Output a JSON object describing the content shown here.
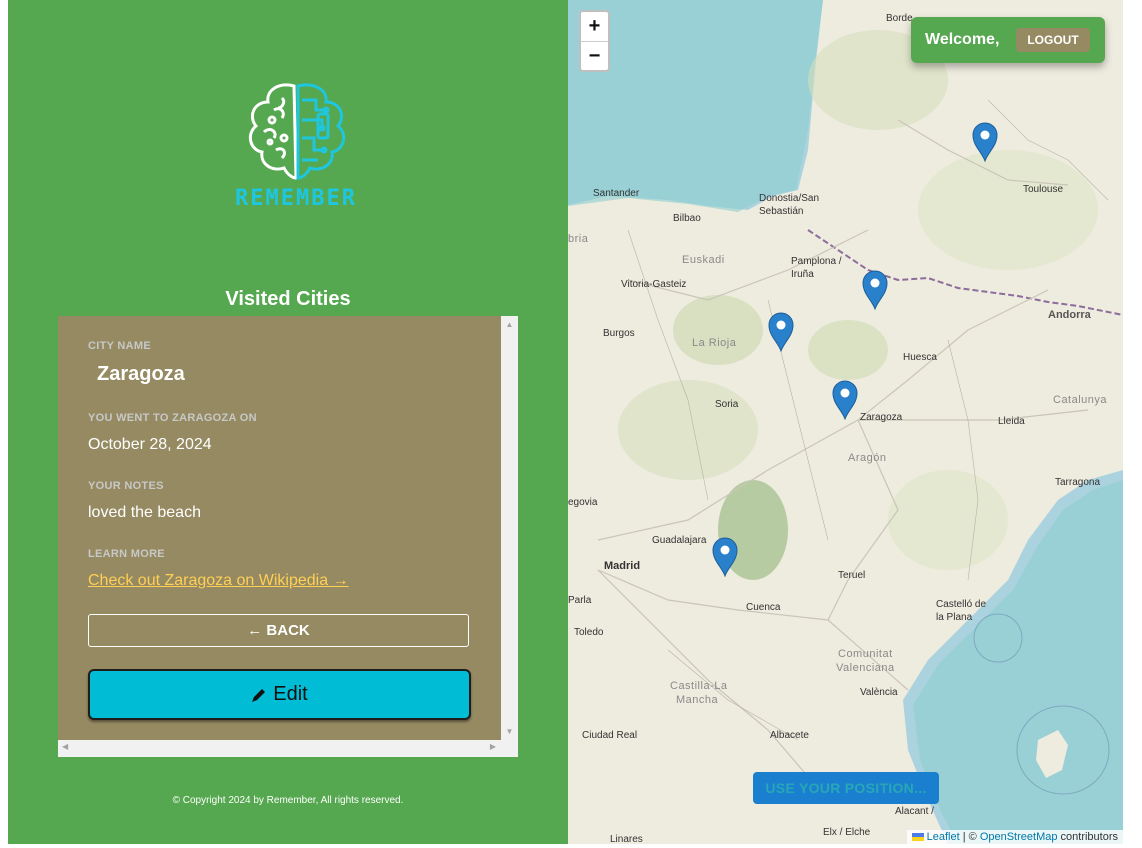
{
  "sidebar": {
    "logo_text": "REMEMBER",
    "section_title": "Visited Cities",
    "city_label": "City name",
    "city_name": "Zaragoza",
    "date_label": "You went to Zaragoza on",
    "date_value": "October 28, 2024",
    "notes_label": "Your notes",
    "notes_value": "loved the beach",
    "learn_label": "Learn more",
    "wiki_link": "Check out Zaragoza on Wikipedia →",
    "back_button": "← BACK",
    "edit_button": "Edit",
    "footer": "© Copyright 2024 by Remember, All rights reserved."
  },
  "map": {
    "zoom_in": "+",
    "zoom_out": "−",
    "welcome": "Welcome,",
    "logout": "LOGOUT",
    "position_button": "USE YOUR POSITION...",
    "attribution": {
      "leaflet": "Leaflet",
      "separator": " | © ",
      "osm": "OpenStreetMap",
      "contributors": " contributors"
    },
    "places": {
      "bordeaux": "Borde",
      "toulouse": "Toulouse",
      "santander": "Santander",
      "bilbao": "Bilbao",
      "donostia": "Donostia/San",
      "sebastian": "Sebastián",
      "euskadi": "Euskadi",
      "pamplona": "Pamplona /",
      "iruna": "Iruña",
      "vitoria": "Vitoria-Gasteiz",
      "andorra": "Andorra",
      "burgos": "Burgos",
      "larioja": "La Rioja",
      "huesca": "Huesca",
      "cataluna": "Catalunya",
      "soria": "Soria",
      "zaragoza": "Zaragoza",
      "lleida": "Lleida",
      "aragon": "Aragón",
      "tarragona": "Tarragona",
      "segovia": "egovia",
      "guadalajara": "Guadalajara",
      "madrid": "Madrid",
      "teruel": "Teruel",
      "parla": "Parla",
      "cuenca": "Cuenca",
      "castello": "Castelló de",
      "laplana": "la Plana",
      "toledo": "Toledo",
      "comunitat": "Comunitat",
      "valenciana": "Valenciana",
      "castilla": "Castilla-La",
      "mancha": "Mancha",
      "valencia": "València",
      "ciudadreal": "Ciudad Real",
      "albacete": "Albacete",
      "alacant": "Alacant /",
      "elx": "Elx / Elche",
      "linares": "Linares",
      "cantabria": "bria"
    },
    "marker_count": 5
  },
  "colors": {
    "sidebar_bg": "#55a84f",
    "panel_bg": "#958a61",
    "edit_bg": "#00bcd4",
    "link": "#ffcf56",
    "logo": "#1fc6e0",
    "marker": "#2a81cb"
  }
}
